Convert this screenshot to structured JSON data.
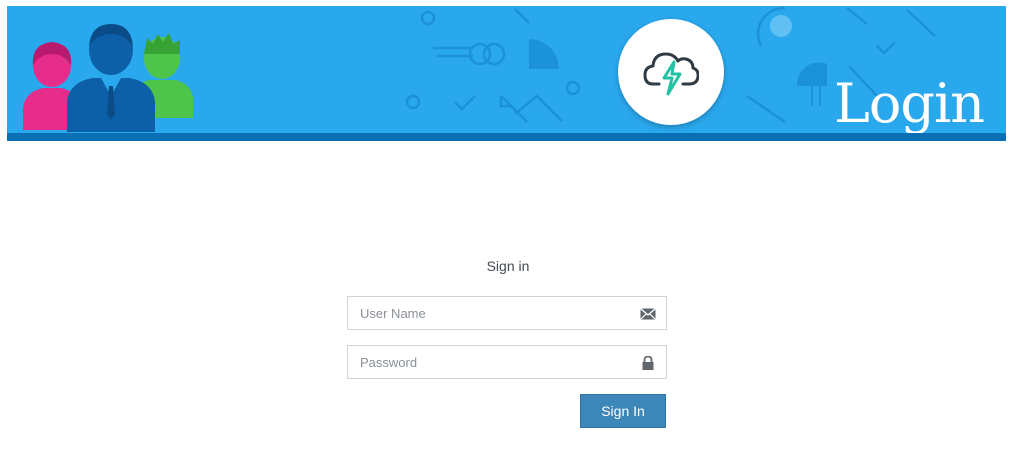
{
  "banner": {
    "title": "Login",
    "colors": {
      "background": "#2aa8ee",
      "strip": "#0b6fb6"
    },
    "illustration_icon": "users-group-icon",
    "logo_icon": "cloud-lightning-icon"
  },
  "form": {
    "heading": "Sign in",
    "username": {
      "placeholder": "User Name",
      "value": "",
      "icon": "envelope-icon"
    },
    "password": {
      "placeholder": "Password",
      "value": "",
      "icon": "lock-icon"
    },
    "submit_label": "Sign In",
    "accent_color": "#3d86b8"
  }
}
